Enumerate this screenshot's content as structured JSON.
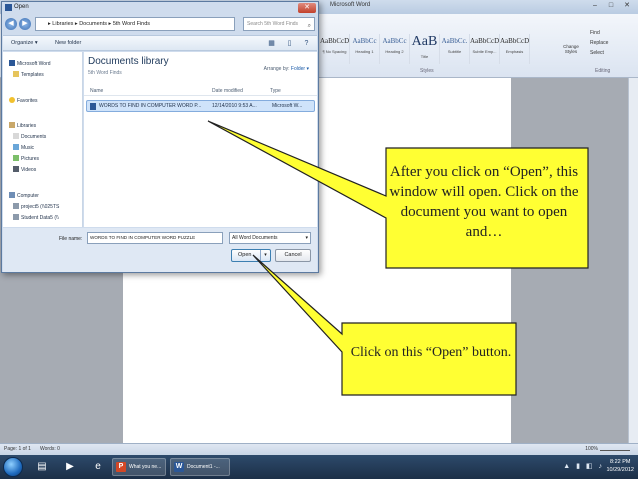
{
  "word": {
    "title": "Microsoft Word",
    "window_controls": [
      "–",
      "□",
      "✕"
    ],
    "styles": [
      {
        "sample": "AaBbCcDd",
        "name": "¶ No Spacing"
      },
      {
        "sample": "AaBbCc",
        "name": "Heading 1"
      },
      {
        "sample": "AaBbCc",
        "name": "Heading 2"
      },
      {
        "sample": "AaB",
        "name": "Title"
      },
      {
        "sample": "AaBbCc.",
        "name": "Subtitle"
      },
      {
        "sample": "AaBbCcDd",
        "name": "Subtle Emp..."
      },
      {
        "sample": "AaBbCcDd",
        "name": "Emphasis"
      }
    ],
    "styles_group_label": "Styles",
    "change_styles": "Change Styles",
    "editing_items": [
      "Find",
      "Replace",
      "Select"
    ],
    "editing_group_label": "Editing",
    "status_page": "Page: 1 of 1",
    "status_words": "Words: 0",
    "zoom": "100%"
  },
  "dialog": {
    "title": "Open",
    "close": "✕",
    "address_path": "▸ Libraries ▸ Documents ▸ 5th Word Finds",
    "search_placeholder": "Search 5th Word Finds",
    "toolbar": {
      "organize": "Organize ▾",
      "new_folder": "New folder"
    },
    "nav": [
      {
        "label": "Microsoft Word",
        "icon": "word-doc-icon"
      },
      {
        "label": "Templates",
        "icon": "folder-icon"
      },
      {
        "label": "Favorites",
        "icon": "star-icon"
      },
      {
        "label": "Libraries",
        "icon": "library-icon"
      },
      {
        "label": "Documents",
        "icon": "documents-icon"
      },
      {
        "label": "Music",
        "icon": "music-icon"
      },
      {
        "label": "Pictures",
        "icon": "pictures-icon"
      },
      {
        "label": "Videos",
        "icon": "videos-icon"
      },
      {
        "label": "Computer",
        "icon": "computer-icon"
      },
      {
        "label": "project5 (\\\\025TS",
        "icon": "network-drive-icon"
      },
      {
        "label": "Student Data5 (\\\\",
        "icon": "network-drive-icon"
      }
    ],
    "library_title": "Documents library",
    "library_sub": "5th Word Finds",
    "arrange_label": "Arrange by:",
    "arrange_value": "Folder ▾",
    "columns": [
      "Name",
      "Date modified",
      "Type"
    ],
    "file": {
      "name": "WORDS TO FIND IN COMPUTER WORD P...",
      "date": "12/14/2010 9:53 A...",
      "type": "Microsoft W..."
    },
    "filename_label": "File name:",
    "filename_value": "WORDS TO FIND IN COMPUTER WORD PUZZLE",
    "filter_value": "All Word Documents",
    "open_label": "Open",
    "cancel_label": "Cancel"
  },
  "taskbar": {
    "buttons": [
      {
        "label": "What you ne...",
        "icon": "P",
        "color": "#d24726"
      },
      {
        "label": "Document1 -...",
        "icon": "W",
        "color": "#2b5797"
      }
    ],
    "time": "8:22 PM",
    "date": "10/29/2012"
  },
  "callouts": {
    "first": "After you click on “Open”, this window will open.  Click on the document you want to open and…",
    "second": "Click on this “Open” button.",
    "fill_color": "#ffff33"
  }
}
